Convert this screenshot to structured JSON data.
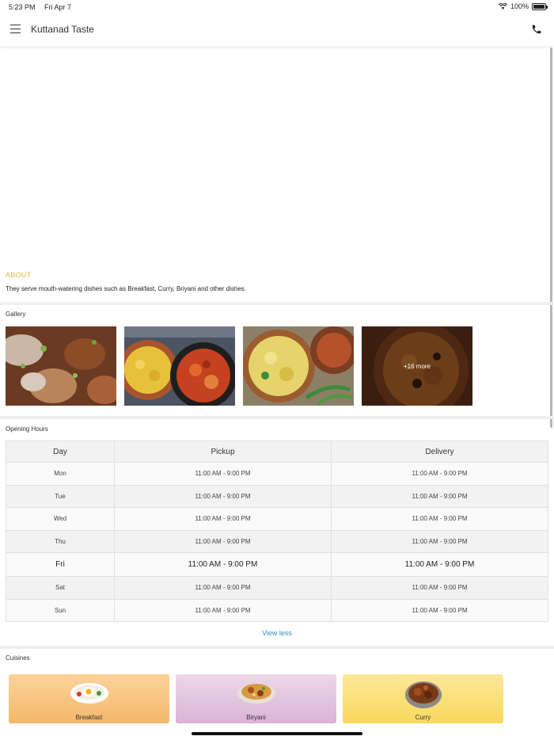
{
  "status": {
    "time": "5:23 PM",
    "date": "Fri Apr 7",
    "battery": "100%",
    "battery_level": 1.0
  },
  "header": {
    "title": "Kuttanad Taste",
    "menu_icon": "hamburger-menu-icon",
    "call_icon": "phone-icon"
  },
  "about": {
    "title": "ABOUT",
    "text": "They serve mouth-watering dishes such as Breakfast, Curry, Briyani and other dishes."
  },
  "gallery": {
    "title": "Gallery",
    "more_label": "+16 more"
  },
  "hours": {
    "title": "Opening Hours",
    "columns": [
      "Day",
      "Pickup",
      "Delivery"
    ],
    "rows": [
      {
        "day": "Mon",
        "pickup": "11:00 AM - 9:00 PM",
        "delivery": "11:00 AM - 9:00 PM"
      },
      {
        "day": "Tue",
        "pickup": "11:00 AM - 9:00 PM",
        "delivery": "11:00 AM - 9:00 PM"
      },
      {
        "day": "Wed",
        "pickup": "11:00 AM - 9:00 PM",
        "delivery": "11:00 AM - 9:00 PM"
      },
      {
        "day": "Thu",
        "pickup": "11:00 AM - 9:00 PM",
        "delivery": "11:00 AM - 9:00 PM"
      },
      {
        "day": "Fri",
        "pickup": "11:00 AM - 9:00 PM",
        "delivery": "11:00 AM - 9:00 PM"
      },
      {
        "day": "Sat",
        "pickup": "11:00 AM - 9:00 PM",
        "delivery": "11:00 AM - 9:00 PM"
      },
      {
        "day": "Sun",
        "pickup": "11:00 AM - 9:00 PM",
        "delivery": "11:00 AM - 9:00 PM"
      }
    ],
    "view_less": "View less"
  },
  "cuisines": {
    "title": "Cuisines",
    "items": [
      {
        "name": "Breakfast"
      },
      {
        "name": "Biryani"
      },
      {
        "name": "Curry"
      }
    ]
  },
  "colors": {
    "accent": "#e6b934",
    "link": "#3a8bc4"
  }
}
